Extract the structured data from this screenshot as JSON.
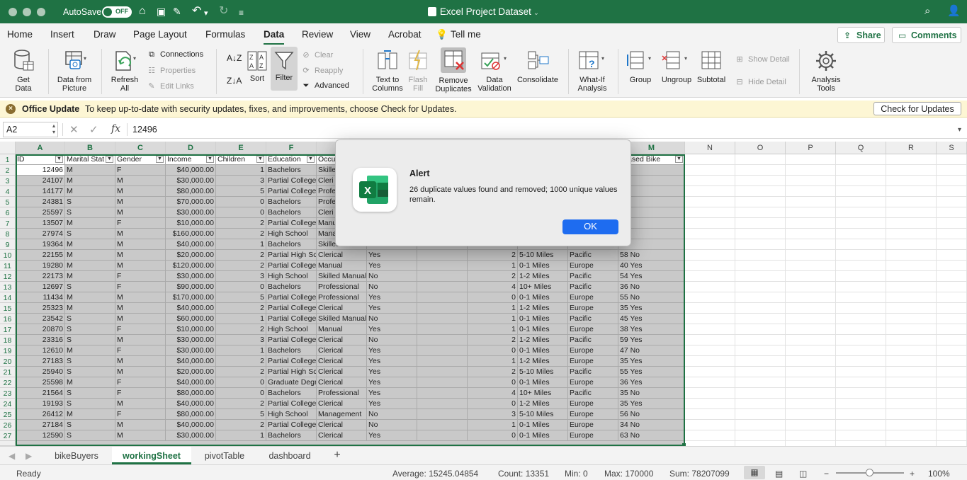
{
  "titlebar": {
    "autosave_label": "AutoSave",
    "autosave_state": "OFF",
    "document_title": "Excel Project Dataset"
  },
  "menu": {
    "tabs": [
      "Home",
      "Insert",
      "Draw",
      "Page Layout",
      "Formulas",
      "Data",
      "Review",
      "View",
      "Acrobat",
      "Tell me"
    ],
    "active": "Data",
    "share_label": "Share",
    "comments_label": "Comments"
  },
  "ribbon": {
    "get_data": [
      "Get",
      "Data"
    ],
    "data_from_picture": [
      "Data from",
      "Picture"
    ],
    "refresh_all": [
      "Refresh",
      "All"
    ],
    "connections": "Connections",
    "properties": "Properties",
    "edit_links": "Edit Links",
    "sort": "Sort",
    "filter": "Filter",
    "clear": "Clear",
    "reapply": "Reapply",
    "advanced": "Advanced",
    "text_to_columns": [
      "Text to",
      "Columns"
    ],
    "flash_fill": [
      "Flash",
      "Fill"
    ],
    "remove_duplicates": [
      "Remove",
      "Duplicates"
    ],
    "data_validation": [
      "Data",
      "Validation"
    ],
    "consolidate": "Consolidate",
    "what_if": [
      "What-If",
      "Analysis"
    ],
    "group": "Group",
    "ungroup": "Ungroup",
    "subtotal": "Subtotal",
    "show_detail": "Show Detail",
    "hide_detail": "Hide Detail",
    "analysis_tools": [
      "Analysis",
      "Tools"
    ]
  },
  "update_bar": {
    "title": "Office Update",
    "message": "To keep up-to-date with security updates, fixes, and improvements, choose Check for Updates.",
    "button": "Check for Updates"
  },
  "formula_bar": {
    "name_box": "A2",
    "fx": "fx",
    "value": "12496"
  },
  "grid": {
    "columns": [
      "A",
      "B",
      "C",
      "D",
      "E",
      "F",
      "G",
      "H",
      "I",
      "J",
      "K",
      "L",
      "M",
      "N",
      "O",
      "P",
      "Q",
      "R",
      "S"
    ],
    "headers": [
      "ID",
      "Marital Stat",
      "Gender",
      "Income",
      "Children",
      "Education",
      "Occu",
      "",
      "",
      "",
      "",
      "",
      "chased Bike"
    ],
    "rows": [
      {
        "n": "2",
        "cells": [
          "12496",
          "M",
          "F",
          "$40,000.00",
          "1",
          "Bachelors",
          "Skille",
          "",
          "",
          "",
          "",
          "",
          ""
        ]
      },
      {
        "n": "3",
        "cells": [
          "24107",
          "M",
          "M",
          "$30,000.00",
          "3",
          "Partial College",
          "Cleri",
          "",
          "",
          "",
          "",
          "",
          ""
        ]
      },
      {
        "n": "4",
        "cells": [
          "14177",
          "M",
          "M",
          "$80,000.00",
          "5",
          "Partial College",
          "Profe",
          "",
          "",
          "",
          "",
          "",
          ""
        ]
      },
      {
        "n": "5",
        "cells": [
          "24381",
          "S",
          "M",
          "$70,000.00",
          "0",
          "Bachelors",
          "Profe",
          "",
          "",
          "",
          "",
          "",
          ""
        ]
      },
      {
        "n": "6",
        "cells": [
          "25597",
          "S",
          "M",
          "$30,000.00",
          "0",
          "Bachelors",
          "Cleri",
          "",
          "",
          "",
          "",
          "",
          ""
        ]
      },
      {
        "n": "7",
        "cells": [
          "13507",
          "M",
          "F",
          "$10,000.00",
          "2",
          "Partial College",
          "Manu",
          "",
          "",
          "",
          "",
          "",
          ""
        ]
      },
      {
        "n": "8",
        "cells": [
          "27974",
          "S",
          "M",
          "$160,000.00",
          "2",
          "High School",
          "Mana",
          "",
          "",
          "",
          "",
          "",
          ""
        ]
      },
      {
        "n": "9",
        "cells": [
          "19364",
          "M",
          "M",
          "$40,000.00",
          "1",
          "Bachelors",
          "Skilled Manual",
          "",
          "",
          "",
          "",
          "",
          ""
        ]
      },
      {
        "n": "10",
        "cells": [
          "22155",
          "M",
          "M",
          "$20,000.00",
          "2",
          "Partial High Sch",
          "Clerical",
          "Yes",
          "",
          "2",
          "5-10 Miles",
          "Pacific",
          "58 No"
        ]
      },
      {
        "n": "11",
        "cells": [
          "19280",
          "M",
          "M",
          "$120,000.00",
          "2",
          "Partial College",
          "Manual",
          "Yes",
          "",
          "1",
          "0-1 Miles",
          "Europe",
          "40 Yes"
        ]
      },
      {
        "n": "12",
        "cells": [
          "22173",
          "M",
          "F",
          "$30,000.00",
          "3",
          "High School",
          "Skilled Manual",
          "No",
          "",
          "2",
          "1-2 Miles",
          "Pacific",
          "54 Yes"
        ]
      },
      {
        "n": "13",
        "cells": [
          "12697",
          "S",
          "F",
          "$90,000.00",
          "0",
          "Bachelors",
          "Professional",
          "No",
          "",
          "4",
          "10+ Miles",
          "Pacific",
          "36 No"
        ]
      },
      {
        "n": "14",
        "cells": [
          "11434",
          "M",
          "M",
          "$170,000.00",
          "5",
          "Partial College",
          "Professional",
          "Yes",
          "",
          "0",
          "0-1 Miles",
          "Europe",
          "55 No"
        ]
      },
      {
        "n": "15",
        "cells": [
          "25323",
          "M",
          "M",
          "$40,000.00",
          "2",
          "Partial College",
          "Clerical",
          "Yes",
          "",
          "1",
          "1-2 Miles",
          "Europe",
          "35 Yes"
        ]
      },
      {
        "n": "16",
        "cells": [
          "23542",
          "S",
          "M",
          "$60,000.00",
          "1",
          "Partial College",
          "Skilled Manual",
          "No",
          "",
          "1",
          "0-1 Miles",
          "Pacific",
          "45 Yes"
        ]
      },
      {
        "n": "17",
        "cells": [
          "20870",
          "S",
          "F",
          "$10,000.00",
          "2",
          "High School",
          "Manual",
          "Yes",
          "",
          "1",
          "0-1 Miles",
          "Europe",
          "38 Yes"
        ]
      },
      {
        "n": "18",
        "cells": [
          "23316",
          "S",
          "M",
          "$30,000.00",
          "3",
          "Partial College",
          "Clerical",
          "No",
          "",
          "2",
          "1-2 Miles",
          "Pacific",
          "59 Yes"
        ]
      },
      {
        "n": "19",
        "cells": [
          "12610",
          "M",
          "F",
          "$30,000.00",
          "1",
          "Bachelors",
          "Clerical",
          "Yes",
          "",
          "0",
          "0-1 Miles",
          "Europe",
          "47 No"
        ]
      },
      {
        "n": "20",
        "cells": [
          "27183",
          "S",
          "M",
          "$40,000.00",
          "2",
          "Partial College",
          "Clerical",
          "Yes",
          "",
          "1",
          "1-2 Miles",
          "Europe",
          "35 Yes"
        ]
      },
      {
        "n": "21",
        "cells": [
          "25940",
          "S",
          "M",
          "$20,000.00",
          "2",
          "Partial High Sch",
          "Clerical",
          "Yes",
          "",
          "2",
          "5-10 Miles",
          "Pacific",
          "55 Yes"
        ]
      },
      {
        "n": "22",
        "cells": [
          "25598",
          "M",
          "F",
          "$40,000.00",
          "0",
          "Graduate Degre",
          "Clerical",
          "Yes",
          "",
          "0",
          "0-1 Miles",
          "Europe",
          "36 Yes"
        ]
      },
      {
        "n": "23",
        "cells": [
          "21564",
          "S",
          "F",
          "$80,000.00",
          "0",
          "Bachelors",
          "Professional",
          "Yes",
          "",
          "4",
          "10+ Miles",
          "Pacific",
          "35 No"
        ]
      },
      {
        "n": "24",
        "cells": [
          "19193",
          "S",
          "M",
          "$40,000.00",
          "2",
          "Partial College",
          "Clerical",
          "Yes",
          "",
          "0",
          "1-2 Miles",
          "Europe",
          "35 Yes"
        ]
      },
      {
        "n": "25",
        "cells": [
          "26412",
          "M",
          "F",
          "$80,000.00",
          "5",
          "High School",
          "Management",
          "No",
          "",
          "3",
          "5-10 Miles",
          "Europe",
          "56 No"
        ]
      },
      {
        "n": "26",
        "cells": [
          "27184",
          "S",
          "M",
          "$40,000.00",
          "2",
          "Partial College",
          "Clerical",
          "No",
          "",
          "1",
          "0-1 Miles",
          "Europe",
          "34 No"
        ]
      },
      {
        "n": "27",
        "cells": [
          "12590",
          "S",
          "M",
          "$30,000.00",
          "1",
          "Bachelors",
          "Clerical",
          "Yes",
          "",
          "0",
          "0-1 Miles",
          "Europe",
          "63 No"
        ]
      }
    ]
  },
  "dialog": {
    "title": "Alert",
    "message": "26 duplicate values found and removed; 1000 unique values remain.",
    "ok": "OK",
    "icon_letter": "X"
  },
  "sheets": {
    "tabs": [
      "bikeBuyers",
      "workingSheet",
      "pivotTable",
      "dashboard"
    ],
    "active": "workingSheet",
    "add": "+"
  },
  "status": {
    "ready": "Ready",
    "average": "Average: 15245.04854",
    "count": "Count: 13351",
    "min": "Min: 0",
    "max": "Max: 170000",
    "sum": "Sum: 78207099",
    "zoom": "100%",
    "zoom_fraction": 0.5
  },
  "colors": {
    "accent": "#1f7244",
    "dialog_button": "#1e6cf0",
    "update_bar": "#fdf6d4"
  }
}
